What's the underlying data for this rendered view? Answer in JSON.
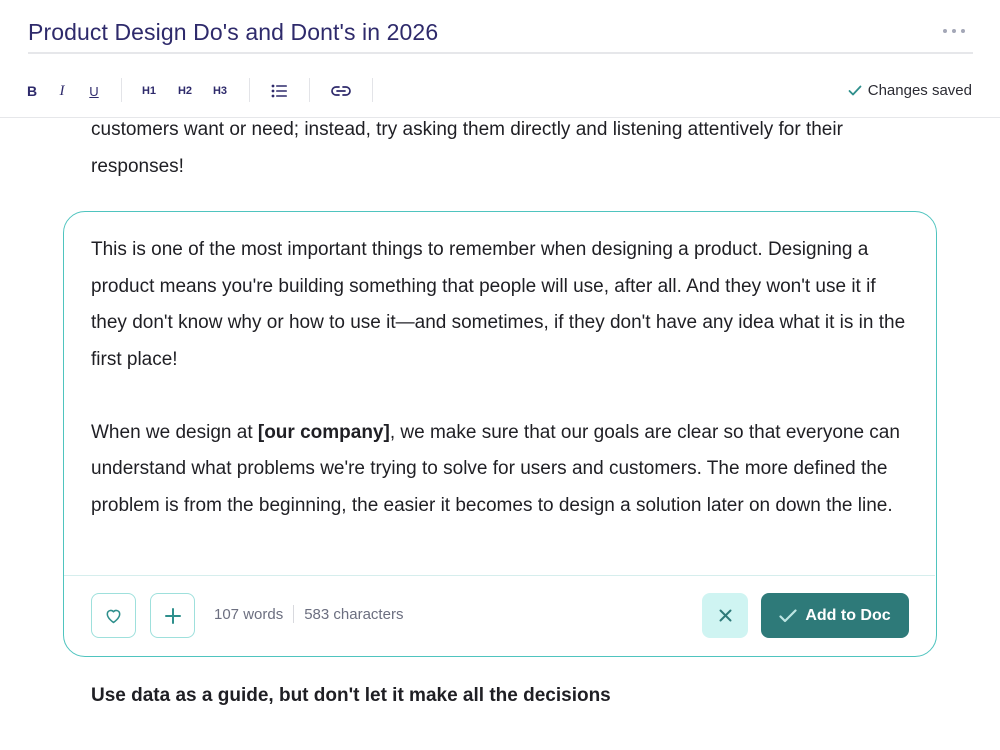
{
  "document": {
    "title": "Product Design Do's and Dont's in 2026",
    "more_icon": "more-horizontal-icon"
  },
  "toolbar": {
    "bold": "B",
    "italic": "I",
    "underline": "U",
    "h1": "H1",
    "h2": "H2",
    "h3": "H3",
    "list_icon": "bulleted-list-icon",
    "link_icon": "link-icon",
    "save_status": "Changes saved",
    "save_icon": "check-icon"
  },
  "content": {
    "intro_paragraph": "customers want or need; instead, try asking them directly and listening attentively for their responses!",
    "suggestion": {
      "paragraph1": "This is one of the most important things to remember when designing a product. Designing a product means you're building something that people will use, after all. And they won't use it if they don't know why or how to use it—and sometimes, if they don't have any idea what it is in the first place!",
      "paragraph2_before": "When we design at ",
      "paragraph2_bold": "[our company]",
      "paragraph2_after": ", we make sure that our goals are clear so that everyone can understand what problems we're trying to solve for users and customers. The more defined the problem is from the beginning, the easier it becomes to design a solution later on down the line.",
      "word_count": "107 words",
      "char_count": "583 characters",
      "add_label": "Add to Doc"
    },
    "next_heading": "Use data as a guide, but don't let it make all the decisions"
  },
  "colors": {
    "title": "#2e2a6b",
    "accent": "#4fc4bf",
    "primary_button": "#2e7a79",
    "secondary_button_bg": "#cff4f2"
  }
}
